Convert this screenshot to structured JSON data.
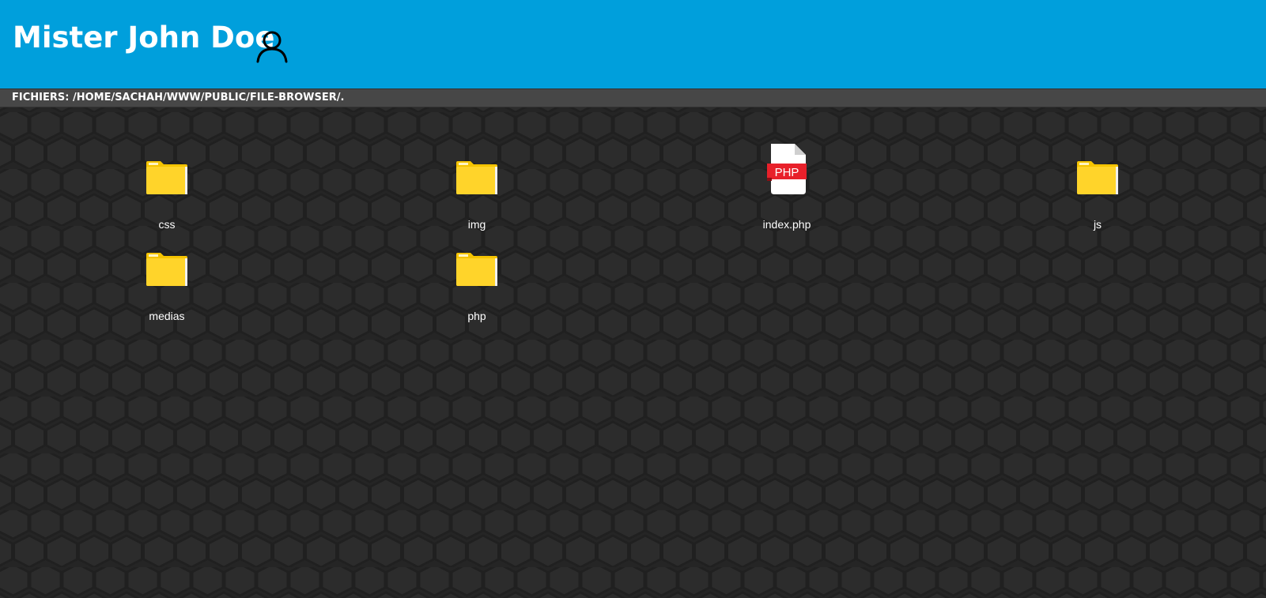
{
  "header": {
    "title": "Mister John Doe",
    "user_icon": "user-icon",
    "background": "#009fdc"
  },
  "pathbar": {
    "text": "FICHIERS: /HOME/SACHAH/WWW/PUBLIC/FILE-BROWSER/."
  },
  "files": [
    {
      "name": "css",
      "type": "folder",
      "icon": "folder-icon"
    },
    {
      "name": "img",
      "type": "folder",
      "icon": "folder-icon"
    },
    {
      "name": "index.php",
      "type": "file",
      "icon": "php-file-icon",
      "badge": "PHP"
    },
    {
      "name": "js",
      "type": "folder",
      "icon": "folder-icon"
    },
    {
      "name": "medias",
      "type": "folder",
      "icon": "folder-icon"
    },
    {
      "name": "php",
      "type": "folder",
      "icon": "folder-icon"
    }
  ],
  "colors": {
    "folder": "#ffd42a",
    "php_badge": "#e8202a",
    "background": "#282828"
  }
}
